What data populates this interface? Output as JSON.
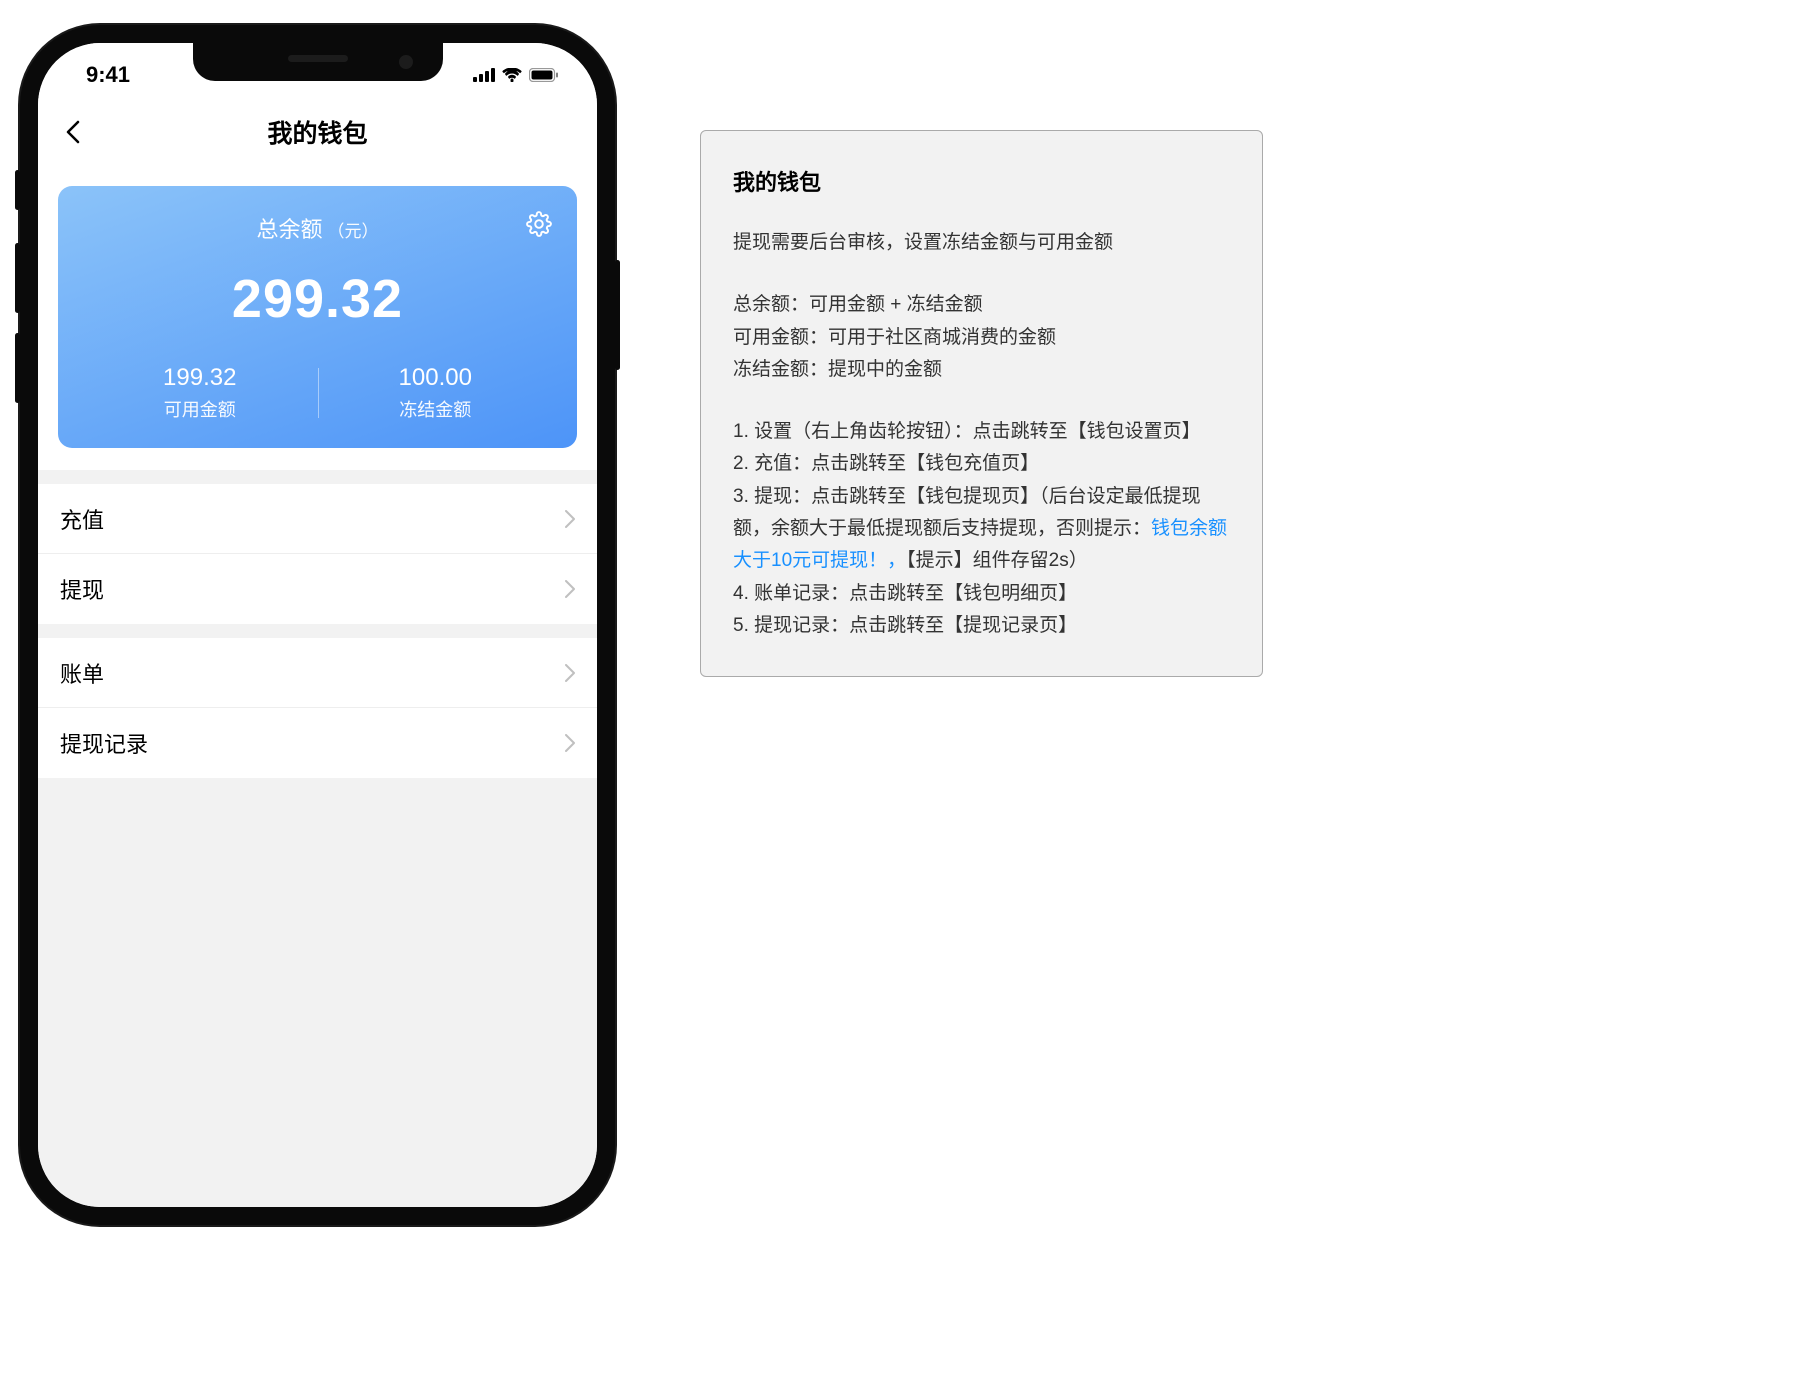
{
  "status": {
    "time": "9:41"
  },
  "nav": {
    "title": "我的钱包"
  },
  "balance": {
    "title": "总余额",
    "unit": "（元）",
    "amount": "299.32",
    "available_value": "199.32",
    "available_label": "可用金额",
    "frozen_value": "100.00",
    "frozen_label": "冻结金额"
  },
  "menu1": {
    "recharge": "充值",
    "withdraw": "提现"
  },
  "menu2": {
    "bill": "账单",
    "withdraw_log": "提现记录"
  },
  "annotation": {
    "title": "我的钱包",
    "p1": "提现需要后台审核，设置冻结金额与可用金额",
    "d1": "总余额：可用金额 + 冻结金额",
    "d2": "可用金额：可用于社区商城消费的金额",
    "d3": "冻结金额：提现中的金额",
    "i1": "1. 设置（右上角齿轮按钮）：点击跳转至【钱包设置页】",
    "i2": "2. 充值：点击跳转至【钱包充值页】",
    "i3a": "3. 提现：点击跳转至【钱包提现页】（后台设定最低提现额，余额大于最低提现额后支持提现，否则提示：",
    "i3link": "钱包余额大于10元可提现！，",
    "i3b": "【提示】组件存留2s）",
    "i4": "4. 账单记录：点击跳转至【钱包明细页】",
    "i5": "5. 提现记录：点击跳转至【提现记录页】"
  }
}
